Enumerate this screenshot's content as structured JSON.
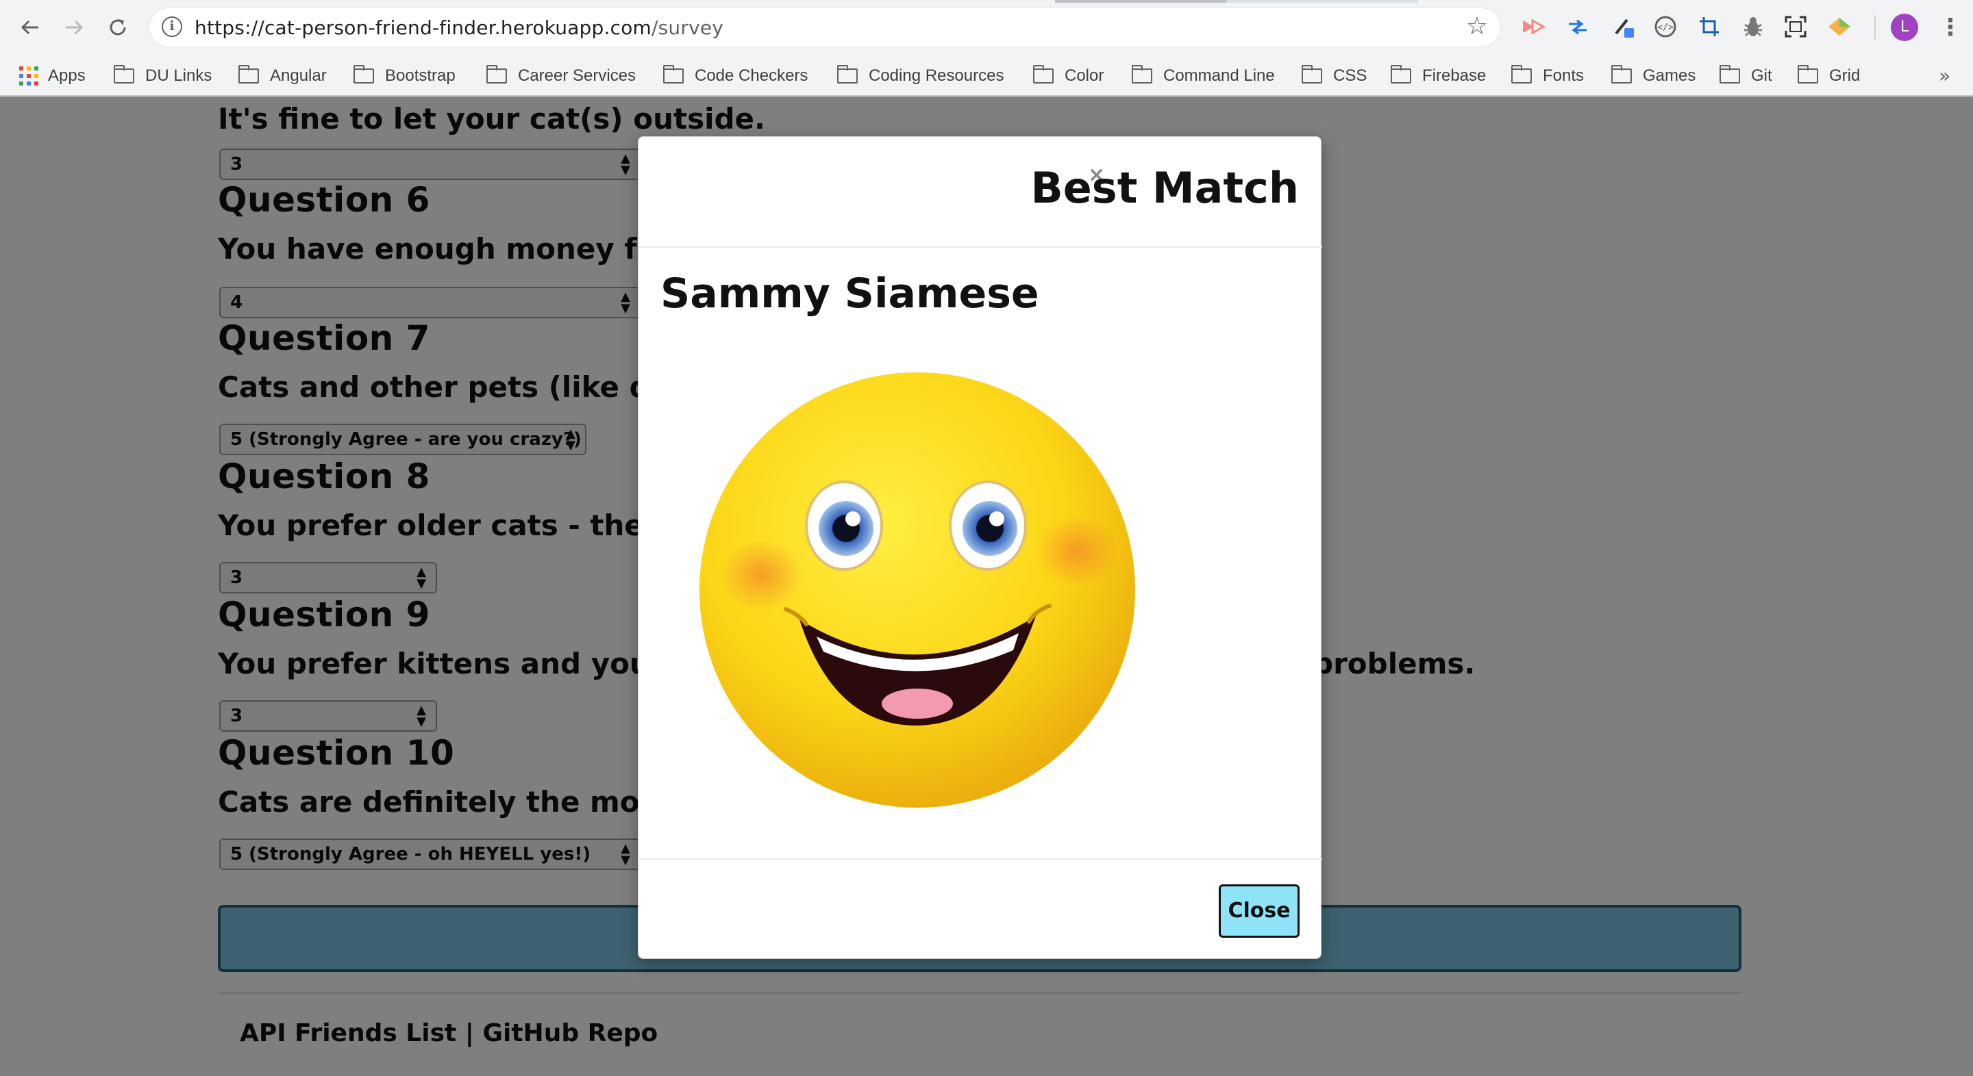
{
  "browser": {
    "url_host": "https://cat-person-friend-finder.herokuapp.com",
    "url_path": "/survey",
    "avatar_letter": "L",
    "bookmarks": [
      "Apps",
      "DU Links",
      "Angular",
      "Bootstrap",
      "Career Services",
      "Code Checkers",
      "Coding Resources",
      "Color",
      "Command Line",
      "CSS",
      "Firebase",
      "Fonts",
      "Games",
      "Git",
      "Grid"
    ],
    "more_bookmarks": "»"
  },
  "survey": {
    "q5_text": "It's fine to let your cat(s) outside.",
    "q5_answer": "3",
    "q6_title": "Question 6",
    "q6_text": "You have enough money for cat f",
    "q6_answer": "4",
    "q7_title": "Question 7",
    "q7_text": "Cats and other pets (like dogs or",
    "q7_answer": "5 (Strongly Agree - are you crazy?)",
    "q8_title": "Question 8",
    "q8_text": "You prefer older cats - they requ",
    "q8_answer": "3",
    "q9_title": "Question 9",
    "q9_text": "You prefer kittens and younger c",
    "q9_text_tail": "problems.",
    "q9_answer": "3",
    "q10_title": "Question 10",
    "q10_text": "Cats are definitely the most intel",
    "q10_answer": "5 (Strongly Agree - oh HEYELL yes!)"
  },
  "footer": {
    "links": "API Friends List | GitHub Repo"
  },
  "modal": {
    "close_x": "×",
    "title": "Best Match",
    "match_name": "Sammy Siamese",
    "close_button": "Close",
    "photo_icon": "smiley-face-icon"
  },
  "colors": {
    "submit_button": "#79c7df",
    "close_button": "#8fe3f6",
    "avatar": "#a142c2"
  }
}
